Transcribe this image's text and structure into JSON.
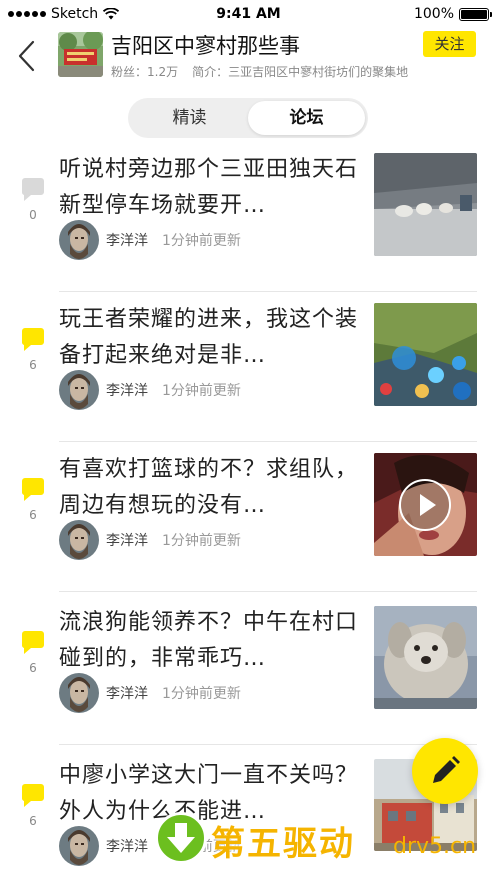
{
  "status_bar": {
    "carrier": "Sketch",
    "time": "9:41 AM",
    "battery": "100%"
  },
  "header": {
    "title": "吉阳区中寥村那些事",
    "fans_label": "粉丝：1.2万",
    "intro_label": "简介：三亚吉阳区中寥村街坊们的聚集地",
    "follow_label": "关注"
  },
  "tabs": [
    {
      "label": "精读",
      "active": false
    },
    {
      "label": "论坛",
      "active": true
    }
  ],
  "posts": [
    {
      "title": "听说村旁边那个三亚田独天石新型停车场就要开…",
      "comments": "0",
      "author": "李洋洋",
      "time": "1分钟前更新",
      "icon_color": "#d9d9d9",
      "thumb": "parking"
    },
    {
      "title": "玩王者荣耀的进来，我这个装备打起来绝对是非…",
      "comments": "6",
      "author": "李洋洋",
      "time": "1分钟前更新",
      "icon_color": "#ffe600",
      "thumb": "game"
    },
    {
      "title": "有喜欢打篮球的不？求组队，周边有想玩的没有…",
      "comments": "6",
      "author": "李洋洋",
      "time": "1分钟前更新",
      "icon_color": "#ffe600",
      "thumb": "video"
    },
    {
      "title": "流浪狗能领养不？中午在村口碰到的，非常乖巧…",
      "comments": "6",
      "author": "李洋洋",
      "time": "1分钟前更新",
      "icon_color": "#ffe600",
      "thumb": "dog"
    },
    {
      "title": "中廖小学这大门一直不关吗？外人为什么不能进…",
      "comments": "6",
      "author": "李洋洋",
      "time": "1分钟前更新",
      "icon_color": "#ffe600",
      "thumb": "school"
    }
  ],
  "watermark": {
    "text": "第五驱动",
    "url": "drv5.cn"
  },
  "colors": {
    "accent": "#ffe600",
    "inactive_icon": "#d9d9d9"
  }
}
